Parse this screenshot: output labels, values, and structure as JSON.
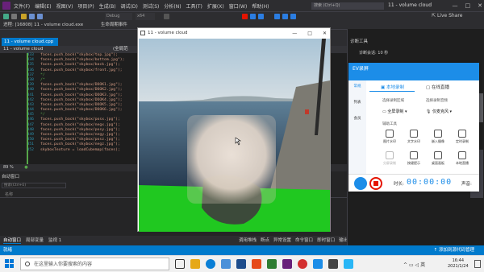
{
  "vs": {
    "menu": [
      "文件(F)",
      "编辑(E)",
      "视图(V)",
      "项目(P)",
      "生成(B)",
      "调试(D)",
      "测试(S)",
      "分析(N)",
      "工具(T)",
      "扩展(X)",
      "窗口(W)",
      "帮助(H)"
    ],
    "search_placeholder": "搜索 (Ctrl+Q)",
    "window_name": "11 - volume cloud",
    "toolbar_config": "Debug",
    "toolbar_platform": "x64",
    "live_share": "Live Share",
    "process": "进程: [16808] 11 - volume cloud.exe",
    "lifecycle": "生命周期事件",
    "editor_tab": "11 - volume cloud.cpp",
    "nav_project": "11 - volume cloud",
    "nav_scope": "(全局范",
    "zoom": "89 %",
    "code_lines": [
      {
        "num": "333",
        "text": "faces.push_back(\"skybox/top.jpg\");"
      },
      {
        "num": "334",
        "text": "faces.push_back(\"skybox/bottom.jpg\");"
      },
      {
        "num": "335",
        "text": "faces.push_back(\"skybox/back.jpg\");"
      },
      {
        "num": "336",
        "text": "faces.push_back(\"skybox/front.jpg\");"
      },
      {
        "num": "337",
        "text": "*/"
      },
      {
        "num": "338",
        "text": "/*"
      },
      {
        "num": "339",
        "text": "faces.push_back(\"skybox/DOOK1.jpg\");"
      },
      {
        "num": "340",
        "text": "faces.push_back(\"skybox/DOOK2.jpg\");"
      },
      {
        "num": "341",
        "text": "faces.push_back(\"skybox/DOOK3.jpg\");"
      },
      {
        "num": "342",
        "text": "faces.push_back(\"skybox/DOOK4.jpg\");"
      },
      {
        "num": "343",
        "text": "faces.push_back(\"skybox/DOOK5.jpg\");"
      },
      {
        "num": "344",
        "text": "faces.push_back(\"skybox/DOOK6.jpg\");"
      },
      {
        "num": "345",
        "text": "*/"
      },
      {
        "num": "346",
        "text": "faces.push_back(\"skybox/posx.jpg\");"
      },
      {
        "num": "347",
        "text": "faces.push_back(\"skybox/negx.jpg\");"
      },
      {
        "num": "348",
        "text": "faces.push_back(\"skybox/posy.jpg\");"
      },
      {
        "num": "349",
        "text": "faces.push_back(\"skybox/negy.jpg\");"
      },
      {
        "num": "350",
        "text": "faces.push_back(\"skybox/posz.jpg\");"
      },
      {
        "num": "351",
        "text": "faces.push_back(\"skybox/negz.jpg\");"
      },
      {
        "num": "352",
        "text": "skyboxTexture = loadCubemap(faces);"
      }
    ],
    "auto_title": "自动窗口",
    "auto_search": "搜索(Ctrl+E)",
    "col_name": "名称",
    "bottom_tabs": [
      "自动窗口",
      "局部变量",
      "监视 1"
    ],
    "right_tabs": [
      "调用堆栈",
      "断点",
      "异常设置",
      "命令窗口",
      "即时窗口",
      "输出"
    ],
    "status_text": "就绪",
    "status_right": "↑ 添加到源代码管理",
    "diag_title": "诊断工具",
    "diag_sub": "诊断会话: 10 秒"
  },
  "vc": {
    "title": "11 - volume cloud"
  },
  "ev": {
    "title": "EV录屏",
    "side": [
      "常规",
      "列表",
      "会员"
    ],
    "tab_local": "本地录制",
    "tab_live": "在线直播",
    "area_label": "选择录制区域",
    "audio_label": "选择录制音频",
    "area_value": "全屏录制",
    "audio_value": "仅麦克风",
    "tools_label": "辅助工具",
    "tools": [
      "图片水印",
      "文字水印",
      "嵌入摄像",
      "定时录制",
      "分屏录制",
      "按键提示",
      "桌面画板",
      "本地直播"
    ],
    "duration_label": "时长:",
    "timer": "00:00:00",
    "volume_label": "声音:"
  },
  "taskbar": {
    "search_placeholder": "在这里输入你要搜索的内容",
    "time": "16:44",
    "date": "2021/1/24",
    "ime": "英"
  }
}
